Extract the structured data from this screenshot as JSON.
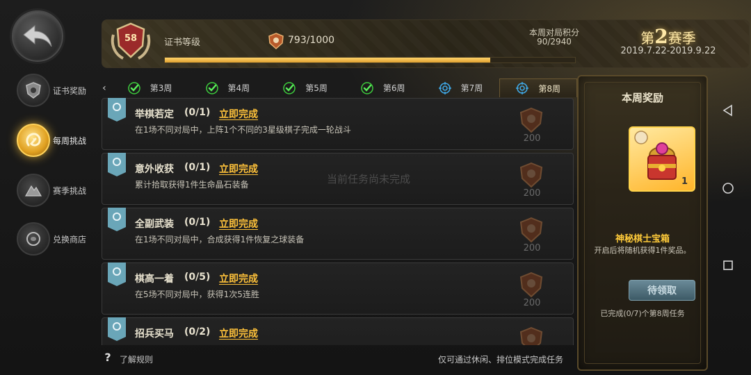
{
  "header": {
    "level": "58",
    "cert_label": "证书等级",
    "points": "793/1000",
    "progress_fraction": 0.793,
    "week_score_label": "本周对局积分",
    "week_score_value": "90/2940",
    "season_prefix": "第",
    "season_number": "2",
    "season_suffix": "赛季",
    "season_dates": "2019.7.22-2019.9.22"
  },
  "sidebar": {
    "items": [
      {
        "label": "证书奖励",
        "icon": "shield-icon",
        "active": false
      },
      {
        "label": "每周挑战",
        "icon": "challenge-icon",
        "active": true
      },
      {
        "label": "赛季挑战",
        "icon": "mountain-icon",
        "active": false
      },
      {
        "label": "兑换商店",
        "icon": "shop-icon",
        "active": false
      }
    ]
  },
  "tabs": [
    {
      "label": "第3周",
      "status": "complete"
    },
    {
      "label": "第4周",
      "status": "complete"
    },
    {
      "label": "第5周",
      "status": "complete"
    },
    {
      "label": "第6周",
      "status": "complete"
    },
    {
      "label": "第7周",
      "status": "target"
    },
    {
      "label": "第8周",
      "status": "target",
      "active": true
    }
  ],
  "tasks": [
    {
      "title": "举棋若定",
      "progress": "(0/1)",
      "action": "立即完成",
      "desc": "在1场不同对局中，上阵1个不同的3星级棋子完成一轮战斗",
      "reward": "200"
    },
    {
      "title": "意外收获",
      "progress": "(0/1)",
      "action": "立即完成",
      "desc": "累计拾取获得1件生命晶石装备",
      "reward": "200"
    },
    {
      "title": "全副武装",
      "progress": "(0/1)",
      "action": "立即完成",
      "desc": "在1场不同对局中，合成获得1件恢复之球装备",
      "reward": "200"
    },
    {
      "title": "棋高一着",
      "progress": "(0/5)",
      "action": "立即完成",
      "desc": "在5场不同对局中，获得1次5连胜",
      "reward": "200"
    },
    {
      "title": "招兵买马",
      "progress": "(0/2)",
      "action": "立即完成",
      "desc": "",
      "reward": ""
    }
  ],
  "overlay_note": "当前任务尚未完成",
  "footer": {
    "help_label": "了解规则",
    "mode_note": "仅可通过休闲、排位模式完成任务"
  },
  "reward": {
    "title": "本周奖励",
    "item_qty": "1",
    "item_name": "神秘棋士宝箱",
    "item_desc": "开启后将随机获得1件奖品。",
    "claim_label": "待领取",
    "done_note": "已完成(0/7)个第8周任务"
  },
  "colors": {
    "accent_gold": "#ffc23a",
    "progress_fill": "#ffd36a",
    "complete_check": "#3ecf3e",
    "target_blue": "#3fa8e6"
  }
}
